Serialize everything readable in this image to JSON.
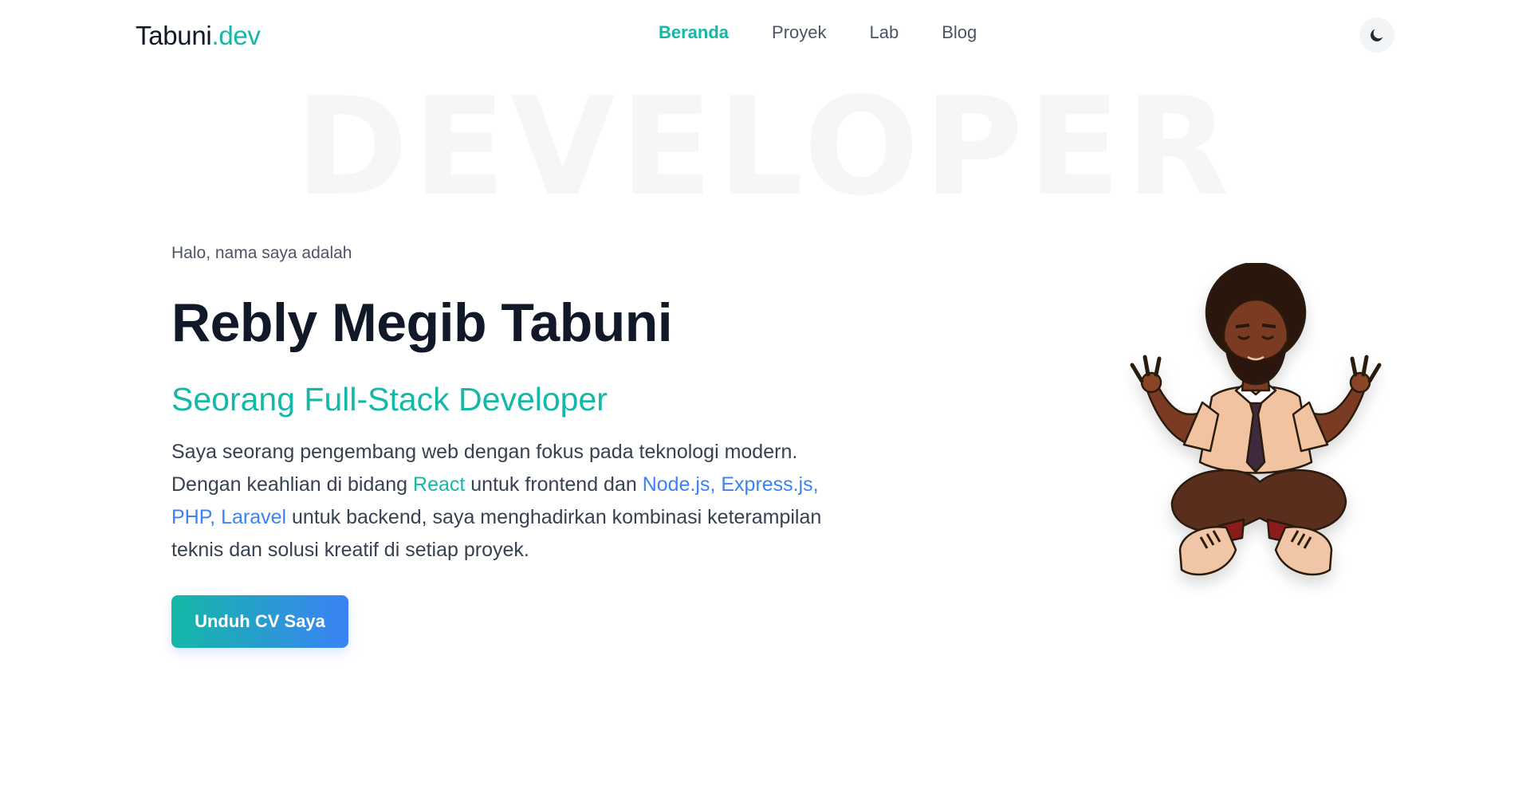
{
  "header": {
    "logo_main": "Tabuni",
    "logo_accent": ".dev",
    "nav": [
      {
        "label": "Beranda",
        "active": true
      },
      {
        "label": "Proyek",
        "active": false
      },
      {
        "label": "Lab",
        "active": false
      },
      {
        "label": "Blog",
        "active": false
      }
    ],
    "theme_icon": "moon-icon"
  },
  "watermark": "DEVELOPER",
  "hero": {
    "greeting": "Halo, nama saya adalah",
    "name": "Rebly Megib Tabuni",
    "role": "Seorang Full-Stack Developer",
    "description": {
      "part1": "Saya seorang pengembang web dengan fokus pada teknologi modern. Dengan keahlian di bidang ",
      "frontend_tech": "React",
      "part2": " untuk frontend dan ",
      "backend_tech": "Node.js, Express.js, PHP, Laravel",
      "part3": " untuk backend, saya menghadirkan kombinasi keterampilan teknis dan solusi kreatif di setiap proyek."
    },
    "cta_label": "Unduh CV Saya"
  },
  "colors": {
    "accent_teal": "#14b8a6",
    "accent_blue": "#3b82f6",
    "text_dark": "#111827"
  }
}
